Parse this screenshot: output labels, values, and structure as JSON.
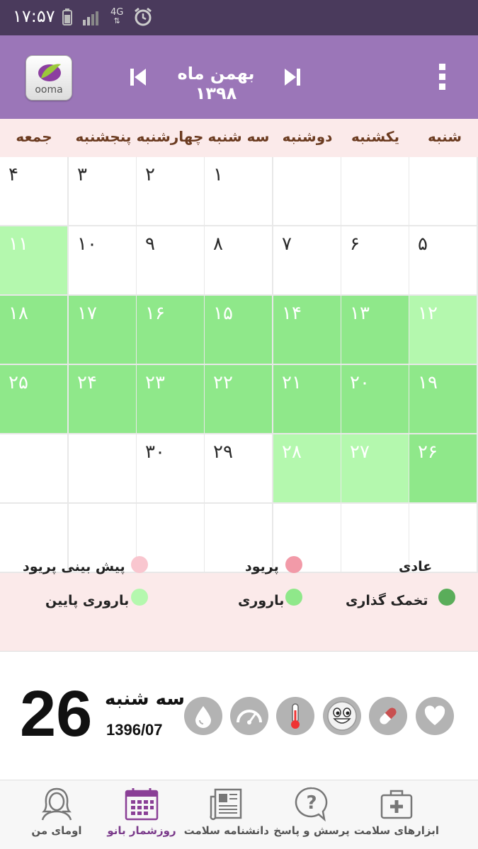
{
  "status_bar": {
    "time": "۱۷:۵۷",
    "network": "4G"
  },
  "header": {
    "logo_text": "ooma",
    "month_title": "بهمن ماه ۱۳۹۸"
  },
  "weekdays": [
    "شنبه",
    "یکشنبه",
    "دوشنبه",
    "سه شنبه",
    "چهارشنبه",
    "پنجشنبه",
    "جمعه"
  ],
  "calendar": {
    "rows": [
      [
        {
          "n": "",
          "t": "empty"
        },
        {
          "n": "",
          "t": "empty"
        },
        {
          "n": "",
          "t": "empty"
        },
        {
          "n": "۱",
          "t": "normal"
        },
        {
          "n": "۲",
          "t": "normal"
        },
        {
          "n": "۳",
          "t": "normal"
        },
        {
          "n": "۴",
          "t": "normal"
        }
      ],
      [
        {
          "n": "۵",
          "t": "normal"
        },
        {
          "n": "۶",
          "t": "normal"
        },
        {
          "n": "۷",
          "t": "normal"
        },
        {
          "n": "۸",
          "t": "normal"
        },
        {
          "n": "۹",
          "t": "normal"
        },
        {
          "n": "۱۰",
          "t": "normal"
        },
        {
          "n": "۱۱",
          "t": "lowfertile"
        }
      ],
      [
        {
          "n": "۱۲",
          "t": "lowfertile"
        },
        {
          "n": "۱۳",
          "t": "fertile"
        },
        {
          "n": "۱۴",
          "t": "fertile"
        },
        {
          "n": "۱۵",
          "t": "fertile"
        },
        {
          "n": "۱۶",
          "t": "fertile"
        },
        {
          "n": "۱۷",
          "t": "fertile"
        },
        {
          "n": "۱۸",
          "t": "fertile"
        }
      ],
      [
        {
          "n": "۱۹",
          "t": "fertile"
        },
        {
          "n": "۲۰",
          "t": "fertile"
        },
        {
          "n": "۲۱",
          "t": "fertile"
        },
        {
          "n": "۲۲",
          "t": "fertile"
        },
        {
          "n": "۲۳",
          "t": "fertile"
        },
        {
          "n": "۲۴",
          "t": "fertile"
        },
        {
          "n": "۲۵",
          "t": "fertile"
        }
      ],
      [
        {
          "n": "۲۶",
          "t": "fertile"
        },
        {
          "n": "۲۷",
          "t": "lowfertile"
        },
        {
          "n": "۲۸",
          "t": "lowfertile"
        },
        {
          "n": "۲۹",
          "t": "normal"
        },
        {
          "n": "۳۰",
          "t": "normal"
        },
        {
          "n": "",
          "t": "empty"
        },
        {
          "n": "",
          "t": "empty"
        }
      ],
      [
        {
          "n": "",
          "t": "empty"
        },
        {
          "n": "",
          "t": "empty"
        },
        {
          "n": "",
          "t": "empty"
        },
        {
          "n": "",
          "t": "empty"
        },
        {
          "n": "",
          "t": "empty"
        },
        {
          "n": "",
          "t": "empty"
        },
        {
          "n": "",
          "t": "empty"
        }
      ]
    ]
  },
  "legend": {
    "normal": "عادی",
    "period": "پریود",
    "period_prediction": "پیش بینی پریود",
    "ovulation": "تخمک گذاری",
    "fertility": "باروری",
    "low_fertility": "باروری پایین"
  },
  "colors": {
    "status_bar": "#4a3a5c",
    "app_bar": "#9b76b8",
    "weekday_bg": "#fbeaea",
    "fertile": "#8fe88a",
    "low_fertile": "#b4f8ae",
    "ovulation": "#5aad5a",
    "period": "#f29aa8",
    "period_prediction": "#f9c6cf"
  },
  "today": {
    "day_number": "26",
    "day_name": "سه شنبه",
    "date": "1396/07"
  },
  "today_icons": [
    "heart-icon",
    "pill-icon",
    "smiley-icon",
    "thermometer-icon",
    "scale-icon",
    "water-drop-icon"
  ],
  "bottom_nav": [
    {
      "label": "ابزارهای سلامت",
      "icon": "first-aid-kit-icon"
    },
    {
      "label": "پرسش و پاسخ",
      "icon": "question-bubble-icon"
    },
    {
      "label": "دانشنامه سلامت",
      "icon": "newspaper-icon"
    },
    {
      "label": "روزشمار بانو",
      "icon": "calendar-icon"
    },
    {
      "label": "اومای من",
      "icon": "woman-avatar-icon"
    }
  ]
}
